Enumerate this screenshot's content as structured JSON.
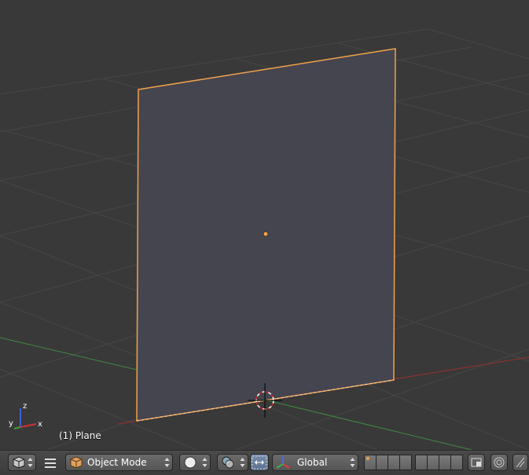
{
  "viewport": {
    "object_label": "(1) Plane",
    "axes": {
      "x": "x",
      "y": "y",
      "z": "z"
    }
  },
  "header": {
    "editor_type_icon": "cube-view-icon",
    "menu_icon": "hamburger-menu-icon",
    "mode": {
      "label": "Object Mode",
      "icon": "object-cube-icon"
    },
    "shading": {
      "icon": "solid-sphere-icon"
    },
    "pivot": {
      "icon": "pivot-point-icon"
    },
    "manipulator": {
      "icon": "manipulator-toggle-icon"
    },
    "orientation": {
      "label": "Global",
      "icon": "transform-axes-icon"
    },
    "layers_icon": "layer-grid-icon",
    "snap_icon": "snap-magnet-icon",
    "proportional_icon": "proportional-edit-icon",
    "render_icon": "render-preview-icon"
  },
  "colors": {
    "viewport_bg": "#393939",
    "grid": "#454545",
    "selection_orange": "#f0a24a",
    "plane_face": "#454550",
    "x_axis": "#9a3030",
    "y_axis": "#3f8a3f"
  }
}
